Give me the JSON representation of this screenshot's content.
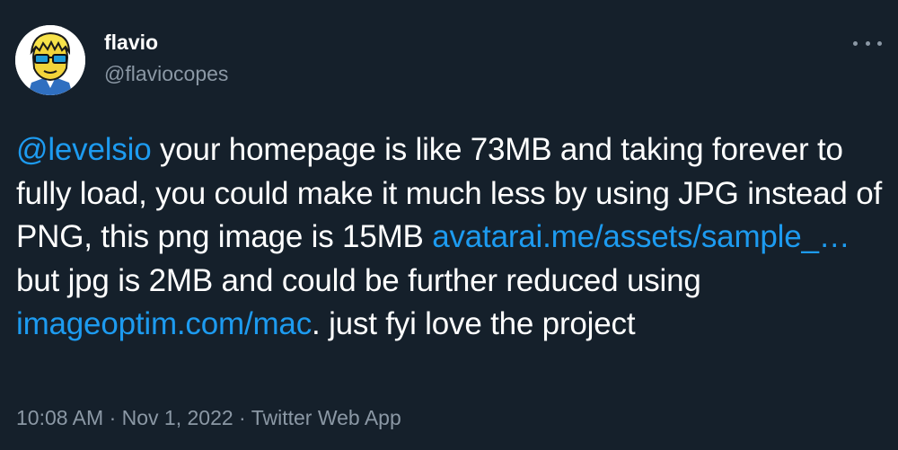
{
  "user": {
    "name": "flavio",
    "handle": "@flaviocopes"
  },
  "tweet": {
    "segments": [
      {
        "type": "mention",
        "text": "@levelsio"
      },
      {
        "type": "text",
        "text": " your homepage is like 73MB and taking forever to fully load, you could make it much less by using JPG instead of PNG, this png image is 15MB "
      },
      {
        "type": "link",
        "text": "avatarai.me/assets/sample_…"
      },
      {
        "type": "text",
        "text": " but jpg is 2MB and could be further reduced using "
      },
      {
        "type": "link",
        "text": "imageoptim.com/mac"
      },
      {
        "type": "text",
        "text": ". just fyi love the project"
      }
    ]
  },
  "meta": {
    "time": "10:08 AM",
    "separator": " · ",
    "date": "Nov 1, 2022",
    "source": "Twitter Web App"
  },
  "icons": {
    "more": "more-options-icon",
    "avatar": "avatar-cartoon"
  },
  "colors": {
    "background": "#15202b",
    "link": "#1d9bf0",
    "secondary_text": "#8b98a5",
    "primary_text": "#ffffff"
  }
}
